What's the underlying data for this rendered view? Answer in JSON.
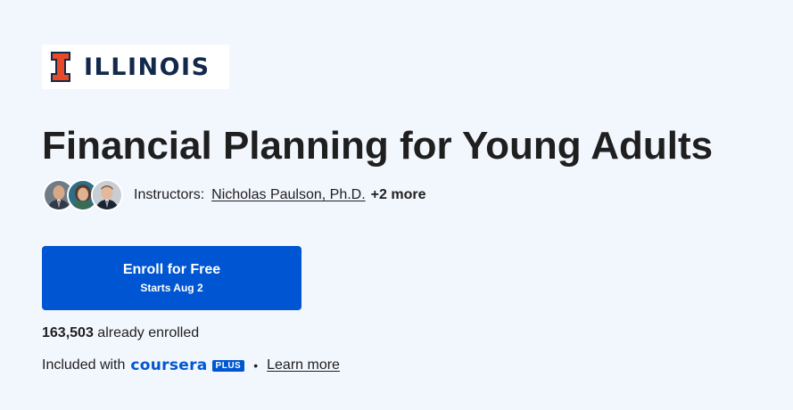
{
  "brand": {
    "logo_text": "ILLINOIS",
    "logo_icon": "block-i-icon",
    "accent_color": "#e84a27",
    "navy_color": "#13294b"
  },
  "course": {
    "title": "Financial Planning for Young Adults"
  },
  "instructors": {
    "label": "Instructors:",
    "primary": "Nicholas Paulson, Ph.D.",
    "more": "+2 more",
    "avatar_count": 3
  },
  "enroll": {
    "label": "Enroll for Free",
    "sub_label": "Starts Aug 2",
    "color": "#0056d2"
  },
  "enrollment": {
    "count": "163,503",
    "suffix": "already enrolled"
  },
  "included": {
    "prefix": "Included with",
    "brand_word": "coursera",
    "badge": "PLUS",
    "separator": "•",
    "link": "Learn more"
  }
}
